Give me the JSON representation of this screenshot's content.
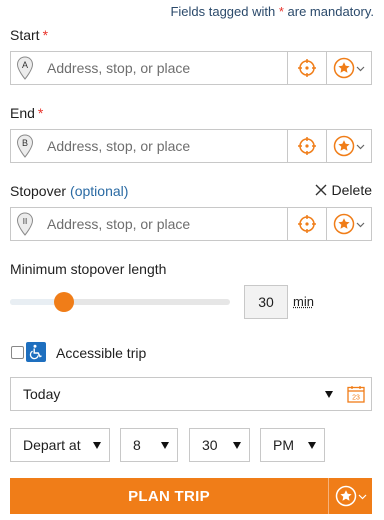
{
  "header": {
    "mandatory_prefix": "Fields tagged with ",
    "mandatory_star": "*",
    "mandatory_suffix": " are mandatory."
  },
  "start": {
    "label": "Start",
    "required": "*",
    "placeholder": "Address, stop, or place",
    "pin_letter": "A"
  },
  "end": {
    "label": "End",
    "required": "*",
    "placeholder": "Address, stop, or place",
    "pin_letter": "B"
  },
  "stopover": {
    "label": "Stopover",
    "optional": "(optional)",
    "delete_label": "Delete",
    "placeholder": "Address, stop, or place",
    "pin_letter": "II"
  },
  "min_stopover": {
    "label": "Minimum stopover length",
    "value": "30",
    "unit": "min",
    "slider_fraction": 0.23
  },
  "accessible": {
    "label": "Accessible trip",
    "checked": false
  },
  "date": {
    "selected": "Today",
    "calendar_day": "23"
  },
  "time": {
    "mode": "Depart at",
    "hour": "8",
    "minute": "30",
    "ampm": "PM"
  },
  "plan": {
    "label": "PLAN TRIP"
  },
  "colors": {
    "accent": "#f07d18",
    "required": "#e8332b",
    "link": "#2a6aa3",
    "accessible": "#1e6fbf"
  }
}
